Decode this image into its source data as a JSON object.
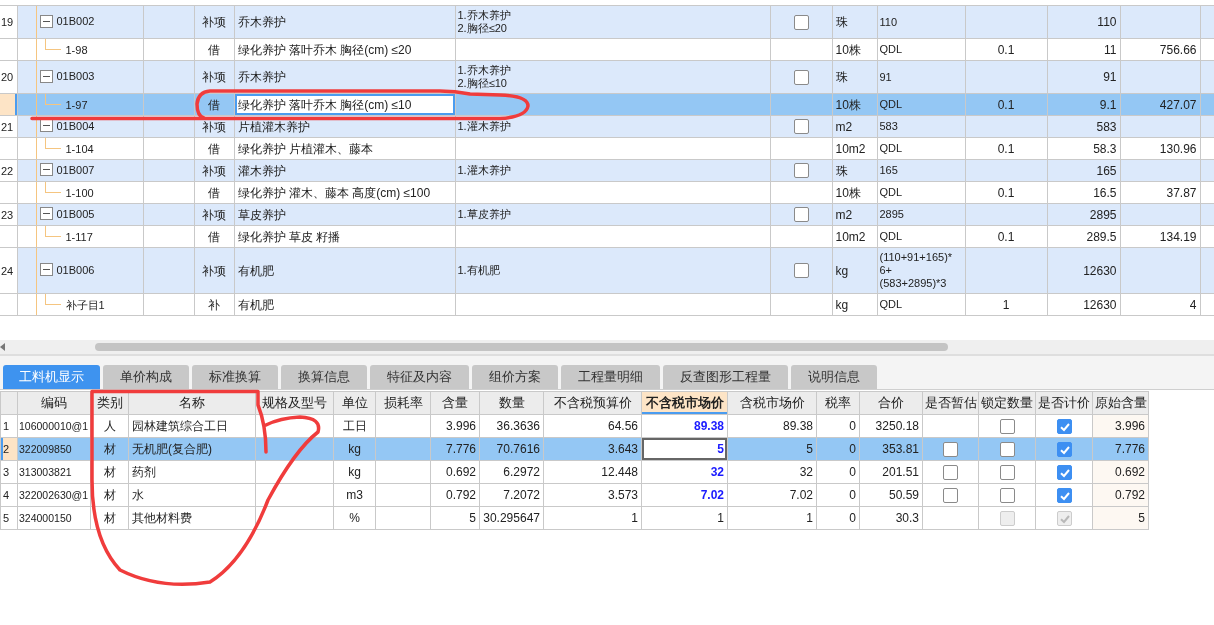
{
  "upper_table": {
    "rows": [
      {
        "number": "19",
        "code": "01B002",
        "expanded": true,
        "selected": false,
        "type": "补项",
        "name": "乔木养护",
        "features": [
          "1.乔木养护",
          "2.胸径≤20"
        ],
        "checked": false,
        "unit": "珠",
        "expression": [
          "110"
        ],
        "quantity": "110",
        "children": [
          {
            "code": "1-98",
            "selected": false,
            "type": "借",
            "name": "绿化养护 落叶乔木 胸径(cm) ≤20",
            "unit": "10株",
            "expression": [
              "QDL"
            ],
            "factor": "0.1",
            "quantity": "11",
            "price": "756.66"
          }
        ]
      },
      {
        "number": "20",
        "code": "01B003",
        "expanded": true,
        "selected": false,
        "type": "补项",
        "name": "乔木养护",
        "features": [
          "1.乔木养护",
          "2.胸径≤10"
        ],
        "checked": false,
        "unit": "珠",
        "expression": [
          "91"
        ],
        "quantity": "91",
        "children": [
          {
            "code": "1-97",
            "selected": true,
            "type": "借",
            "name": "绿化养护 落叶乔木 胸径(cm) ≤10",
            "unit": "10株",
            "expression": [
              "QDL"
            ],
            "factor": "0.1",
            "quantity": "9.1",
            "price": "427.07"
          }
        ]
      },
      {
        "number": "21",
        "code": "01B004",
        "expanded": true,
        "selected": false,
        "type": "补项",
        "name": "片植灌木养护",
        "features": [
          "1.灌木养护"
        ],
        "checked": false,
        "unit": "m2",
        "expression": [
          "583"
        ],
        "quantity": "583",
        "children": [
          {
            "code": "1-104",
            "selected": false,
            "type": "借",
            "name": "绿化养护 片植灌木、藤本",
            "unit": "10m2",
            "expression": [
              "QDL"
            ],
            "factor": "0.1",
            "quantity": "58.3",
            "price": "130.96"
          }
        ]
      },
      {
        "number": "22",
        "code": "01B007",
        "expanded": true,
        "selected": false,
        "type": "补项",
        "name": "灌木养护",
        "features": [
          "1.灌木养护"
        ],
        "checked": false,
        "unit": "珠",
        "expression": [
          "165"
        ],
        "quantity": "165",
        "children": [
          {
            "code": "1-100",
            "selected": false,
            "type": "借",
            "name": "绿化养护 灌木、藤本 高度(cm) ≤100",
            "unit": "10株",
            "expression": [
              "QDL"
            ],
            "factor": "0.1",
            "quantity": "16.5",
            "price": "37.87"
          }
        ]
      },
      {
        "number": "23",
        "code": "01B005",
        "expanded": true,
        "selected": false,
        "type": "补项",
        "name": "草皮养护",
        "features": [
          "1.草皮养护"
        ],
        "checked": false,
        "unit": "m2",
        "expression": [
          "2895"
        ],
        "quantity": "2895",
        "children": [
          {
            "code": "1-117",
            "selected": false,
            "type": "借",
            "name": "绿化养护 草皮 籽播",
            "unit": "10m2",
            "expression": [
              "QDL"
            ],
            "factor": "0.1",
            "quantity": "289.5",
            "price": "134.19"
          }
        ]
      },
      {
        "number": "24",
        "code": "01B006",
        "expanded": true,
        "selected": false,
        "type": "补项",
        "name": "有机肥",
        "features": [
          "1.有机肥"
        ],
        "checked": false,
        "unit": "kg",
        "expression": [
          "(110+91+165)*",
          "6+",
          "(583+2895)*3"
        ],
        "quantity": "12630",
        "children": [
          {
            "code": "补子目1",
            "selected": false,
            "type": "补",
            "name": "有机肥",
            "unit": "kg",
            "expression": [
              "QDL"
            ],
            "factor": "1",
            "quantity": "12630",
            "price": "4"
          }
        ]
      }
    ]
  },
  "tabs": [
    {
      "label": "工料机显示",
      "selected": true
    },
    {
      "label": "单价构成",
      "selected": false
    },
    {
      "label": "标准换算",
      "selected": false
    },
    {
      "label": "换算信息",
      "selected": false
    },
    {
      "label": "特征及内容",
      "selected": false
    },
    {
      "label": "组价方案",
      "selected": false
    },
    {
      "label": "工程量明细",
      "selected": false
    },
    {
      "label": "反查图形工程量",
      "selected": false
    },
    {
      "label": "说明信息",
      "selected": false
    }
  ],
  "resource_table": {
    "columns": [
      {
        "label": "编码",
        "selected": false
      },
      {
        "label": "类别",
        "selected": false
      },
      {
        "label": "名称",
        "selected": false
      },
      {
        "label": "规格及型号",
        "selected": false
      },
      {
        "label": "单位",
        "selected": false
      },
      {
        "label": "损耗率",
        "selected": false
      },
      {
        "label": "含量",
        "selected": false
      },
      {
        "label": "数量",
        "selected": false
      },
      {
        "label": "不含税预算价",
        "selected": false
      },
      {
        "label": "不含税市场价",
        "selected": true
      },
      {
        "label": "含税市场价",
        "selected": false
      },
      {
        "label": "税率",
        "selected": false
      },
      {
        "label": "合价",
        "selected": false
      },
      {
        "label": "是否暂估",
        "selected": false
      },
      {
        "label": "锁定数量",
        "selected": false
      },
      {
        "label": "是否计价",
        "selected": false
      },
      {
        "label": "原始含量",
        "selected": false
      }
    ],
    "rows": [
      {
        "number": "1",
        "selected": false,
        "code": "106000010@1",
        "category": "人",
        "name": "园林建筑综合工日",
        "unit": "工日",
        "content": "3.996",
        "quantity": "36.3636",
        "budget_price": "64.56",
        "market_price": "89.38",
        "price_changed": true,
        "tax_market_price": "89.38",
        "tax_rate": "0",
        "total": "3250.18",
        "lock_quantity": {
          "checked": false,
          "disabled": false
        },
        "priced": {
          "checked": true,
          "disabled": false
        },
        "original_content": "3.996"
      },
      {
        "number": "2",
        "selected": true,
        "code": "322009850",
        "category": "材",
        "name": "无机肥(复合肥)",
        "unit": "kg",
        "content": "7.776",
        "quantity": "70.7616",
        "budget_price": "3.643",
        "market_price": "5",
        "price_changed": true,
        "tax_market_price": "5",
        "tax_rate": "0",
        "total": "353.81",
        "provisional": {
          "checked": false,
          "disabled": false
        },
        "lock_quantity": {
          "checked": false,
          "disabled": false
        },
        "priced": {
          "checked": true,
          "disabled": false
        },
        "original_content": "7.776"
      },
      {
        "number": "3",
        "selected": false,
        "code": "313003821",
        "category": "材",
        "name": "药剂",
        "unit": "kg",
        "content": "0.692",
        "quantity": "6.2972",
        "budget_price": "12.448",
        "market_price": "32",
        "price_changed": true,
        "tax_market_price": "32",
        "tax_rate": "0",
        "total": "201.51",
        "provisional": {
          "checked": false,
          "disabled": false
        },
        "lock_quantity": {
          "checked": false,
          "disabled": false
        },
        "priced": {
          "checked": true,
          "disabled": false
        },
        "original_content": "0.692"
      },
      {
        "number": "4",
        "selected": false,
        "code": "322002630@1",
        "category": "材",
        "name": "水",
        "unit": "m3",
        "content": "0.792",
        "quantity": "7.2072",
        "budget_price": "3.573",
        "market_price": "7.02",
        "price_changed": true,
        "tax_market_price": "7.02",
        "tax_rate": "0",
        "total": "50.59",
        "provisional": {
          "checked": false,
          "disabled": false
        },
        "lock_quantity": {
          "checked": false,
          "disabled": false
        },
        "priced": {
          "checked": true,
          "disabled": false
        },
        "original_content": "0.792"
      },
      {
        "number": "5",
        "selected": false,
        "code": "324000150",
        "category": "材",
        "name": "其他材料费",
        "unit": "%",
        "content": "5",
        "quantity": "30.295647",
        "budget_price": "1",
        "market_price": "1",
        "price_changed": false,
        "tax_market_price": "1",
        "tax_rate": "0",
        "total": "30.3",
        "lock_quantity": {
          "checked": false,
          "disabled": true
        },
        "priced": {
          "checked": true,
          "disabled": true
        },
        "original_content": "5"
      }
    ]
  }
}
